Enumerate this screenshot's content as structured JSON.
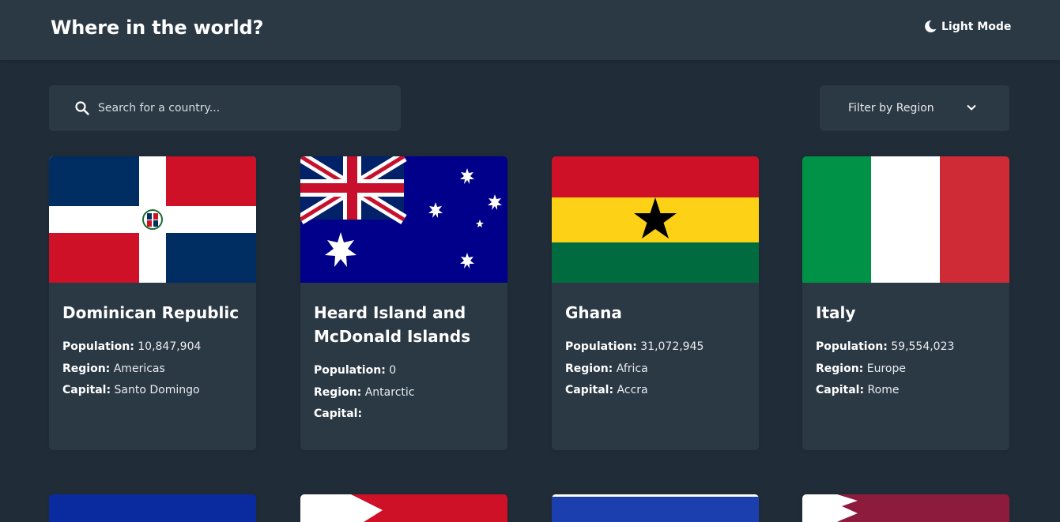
{
  "header": {
    "title": "Where in the world?",
    "mode_label": "Light Mode"
  },
  "search": {
    "placeholder": "Search for a country..."
  },
  "filter": {
    "label": "Filter by Region"
  },
  "labels": {
    "population": "Population:",
    "region": "Region:",
    "capital": "Capital:"
  },
  "countries": [
    {
      "name": "Dominican Republic",
      "population": "10,847,904",
      "region": "Americas",
      "capital": "Santo Domingo"
    },
    {
      "name": "Heard Island and McDonald Islands",
      "population": "0",
      "region": "Antarctic",
      "capital": ""
    },
    {
      "name": "Ghana",
      "population": "31,072,945",
      "region": "Africa",
      "capital": "Accra"
    },
    {
      "name": "Italy",
      "population": "59,554,023",
      "region": "Europe",
      "capital": "Rome"
    }
  ],
  "colors": {
    "background": "#202c37",
    "elements": "#2b3945",
    "text": "#ffffff"
  }
}
